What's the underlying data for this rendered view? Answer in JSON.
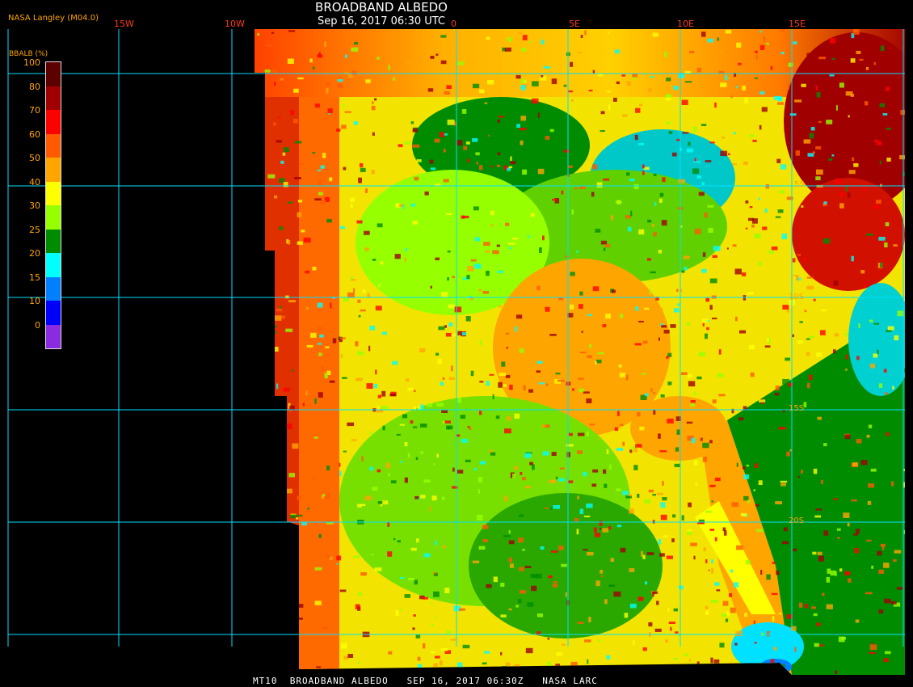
{
  "header": {
    "title": "BROADBAND ALBEDO",
    "subtitle": "Sep 16, 2017 06:30 UTC",
    "provider": "NASA Langley (M04.0)"
  },
  "footer": {
    "text": "MT10  BROADBAND ALBEDO   SEP 16, 2017 06:30Z   NASA LARC"
  },
  "longitude_labels": [
    "15W",
    "10W",
    "0",
    "5E",
    "10E",
    "15E"
  ],
  "latitude_labels": [
    "5S",
    "10S",
    "15S",
    "20S"
  ],
  "legend": {
    "title": "BBALB (%)",
    "ticks": [
      "100",
      "80",
      "70",
      "60",
      "50",
      "40",
      "30",
      "25",
      "20",
      "15",
      "10",
      "0"
    ],
    "colors": [
      "#5c0000",
      "#a00000",
      "#ff0000",
      "#ff5a00",
      "#ffa500",
      "#ffff00",
      "#96ff00",
      "#008c00",
      "#00ffff",
      "#0080ff",
      "#0000ff",
      "#8a2be2"
    ]
  }
}
